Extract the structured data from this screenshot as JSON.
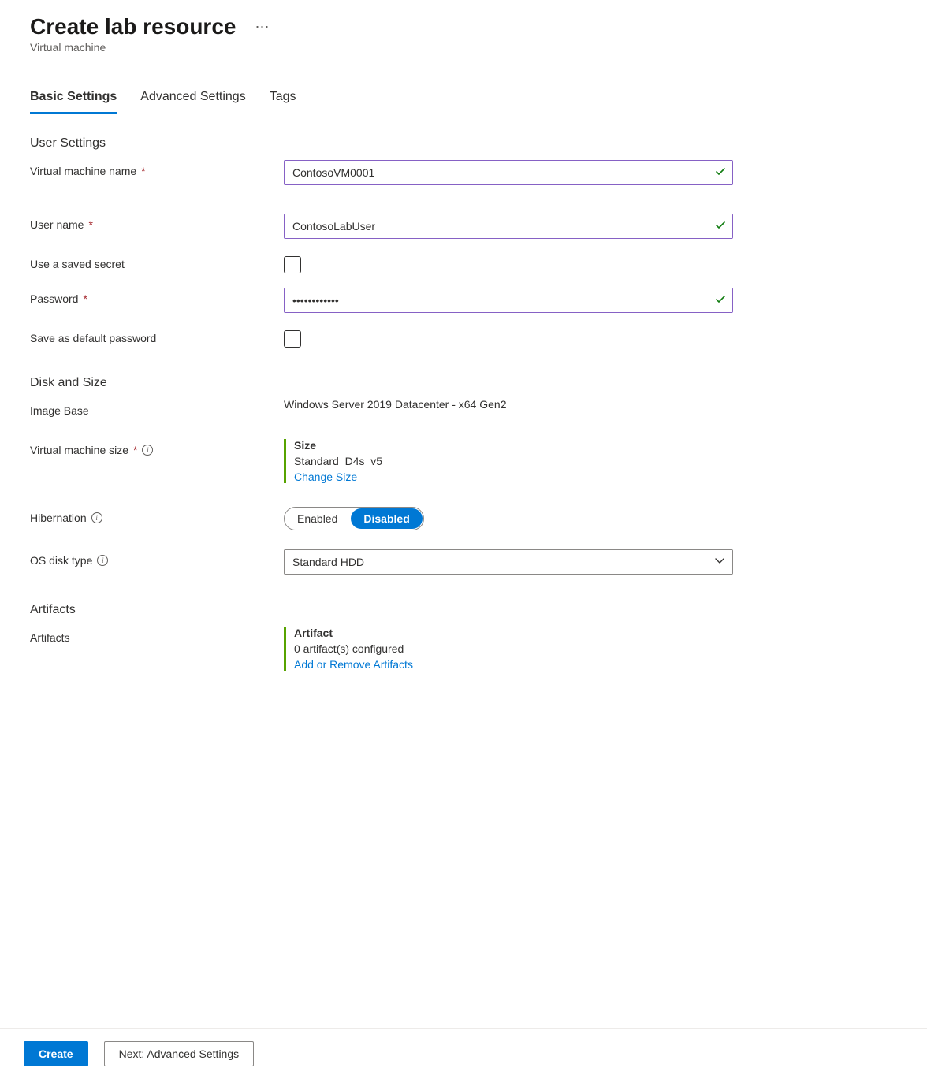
{
  "header": {
    "title": "Create lab resource",
    "subtitle": "Virtual machine"
  },
  "tabs": [
    {
      "label": "Basic Settings",
      "active": true
    },
    {
      "label": "Advanced Settings",
      "active": false
    },
    {
      "label": "Tags",
      "active": false
    }
  ],
  "sections": {
    "userSettings": {
      "heading": "User Settings",
      "vmName": {
        "label": "Virtual machine name",
        "value": "ContosoVM0001",
        "valid": true
      },
      "userName": {
        "label": "User name",
        "value": "ContosoLabUser",
        "valid": true
      },
      "useSavedSecret": {
        "label": "Use a saved secret",
        "checked": false
      },
      "password": {
        "label": "Password",
        "value": "••••••••••••",
        "valid": true
      },
      "saveDefaultPwd": {
        "label": "Save as default password",
        "checked": false
      }
    },
    "diskSize": {
      "heading": "Disk and Size",
      "imageBase": {
        "label": "Image Base",
        "value": "Windows Server 2019 Datacenter - x64 Gen2"
      },
      "vmSize": {
        "label": "Virtual machine size",
        "cardTitle": "Size",
        "value": "Standard_D4s_v5",
        "link": "Change Size"
      },
      "hibernation": {
        "label": "Hibernation",
        "options": [
          "Enabled",
          "Disabled"
        ],
        "selected": "Disabled"
      },
      "osDiskType": {
        "label": "OS disk type",
        "value": "Standard HDD"
      }
    },
    "artifacts": {
      "heading": "Artifacts",
      "row": {
        "label": "Artifacts",
        "cardTitle": "Artifact",
        "value": "0 artifact(s) configured",
        "link": "Add or Remove Artifacts"
      }
    }
  },
  "footer": {
    "primary": "Create",
    "secondary": "Next: Advanced Settings"
  }
}
